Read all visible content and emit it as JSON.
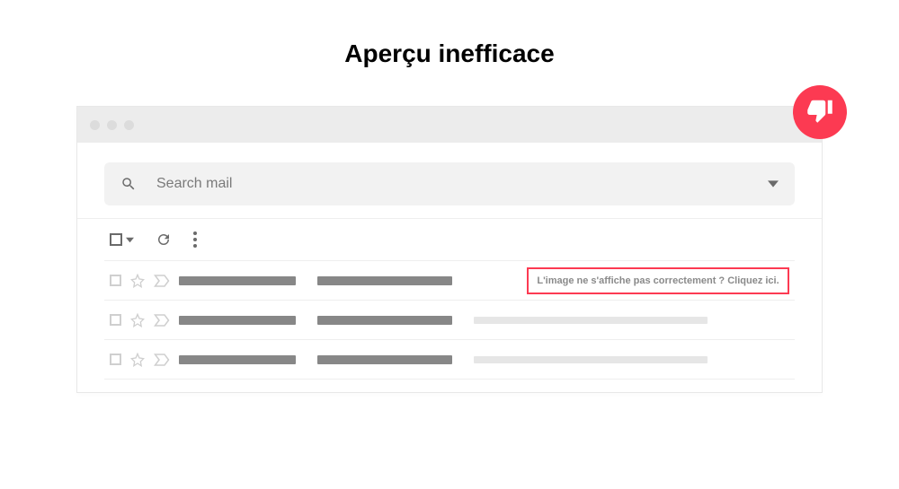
{
  "title": "Aperçu inefficace",
  "search": {
    "placeholder": "Search mail"
  },
  "callout_text": "L'image ne s'affiche pas correctement ? Cliquez ici.",
  "colors": {
    "accent": "#fc3a52"
  }
}
